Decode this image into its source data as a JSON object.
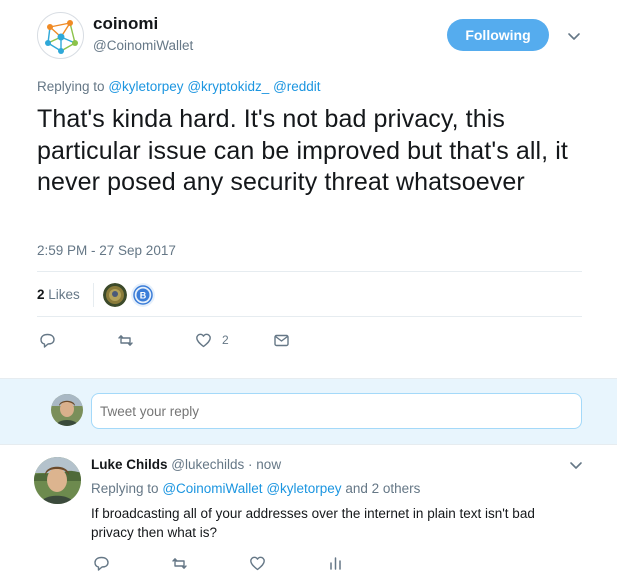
{
  "tweet": {
    "display_name": "coinomi",
    "handle": "@CoinomiWallet",
    "follow_label": "Following",
    "replying_prefix": "Replying to",
    "replying_mentions": [
      "@kyletorpey",
      "@kryptokidz_",
      "@reddit"
    ],
    "text": "That's kinda hard. It's not bad privacy, this particular issue can be improved but that's all, it never posed any security threat whatsoever",
    "timestamp": "2:59 PM - 27 Sep 2017",
    "likes_count": "2",
    "likes_label": "Likes",
    "actions": {
      "reply_icon": "reply-icon",
      "retweet_icon": "retweet-icon",
      "like_icon": "heart-icon",
      "like_count": "2",
      "dm_icon": "envelope-icon"
    }
  },
  "reply_box": {
    "placeholder": "Tweet your reply"
  },
  "reply": {
    "display_name": "Luke Childs",
    "handle": "@lukechilds",
    "separator": "·",
    "time": "now",
    "replying_prefix": "Replying to",
    "replying_mentions": [
      "@CoinomiWallet",
      "@kyletorpey"
    ],
    "replying_suffix": "and 2 others",
    "text": "If broadcasting all of your addresses over the internet in plain text isn't bad privacy then what is?",
    "actions": [
      "reply-icon",
      "retweet-icon",
      "heart-icon",
      "analytics-icon"
    ]
  },
  "colors": {
    "accent": "#1b95e0",
    "follow_button": "#55acee",
    "secondary_text": "#657786",
    "reply_area_bg": "#e8f5fd"
  }
}
